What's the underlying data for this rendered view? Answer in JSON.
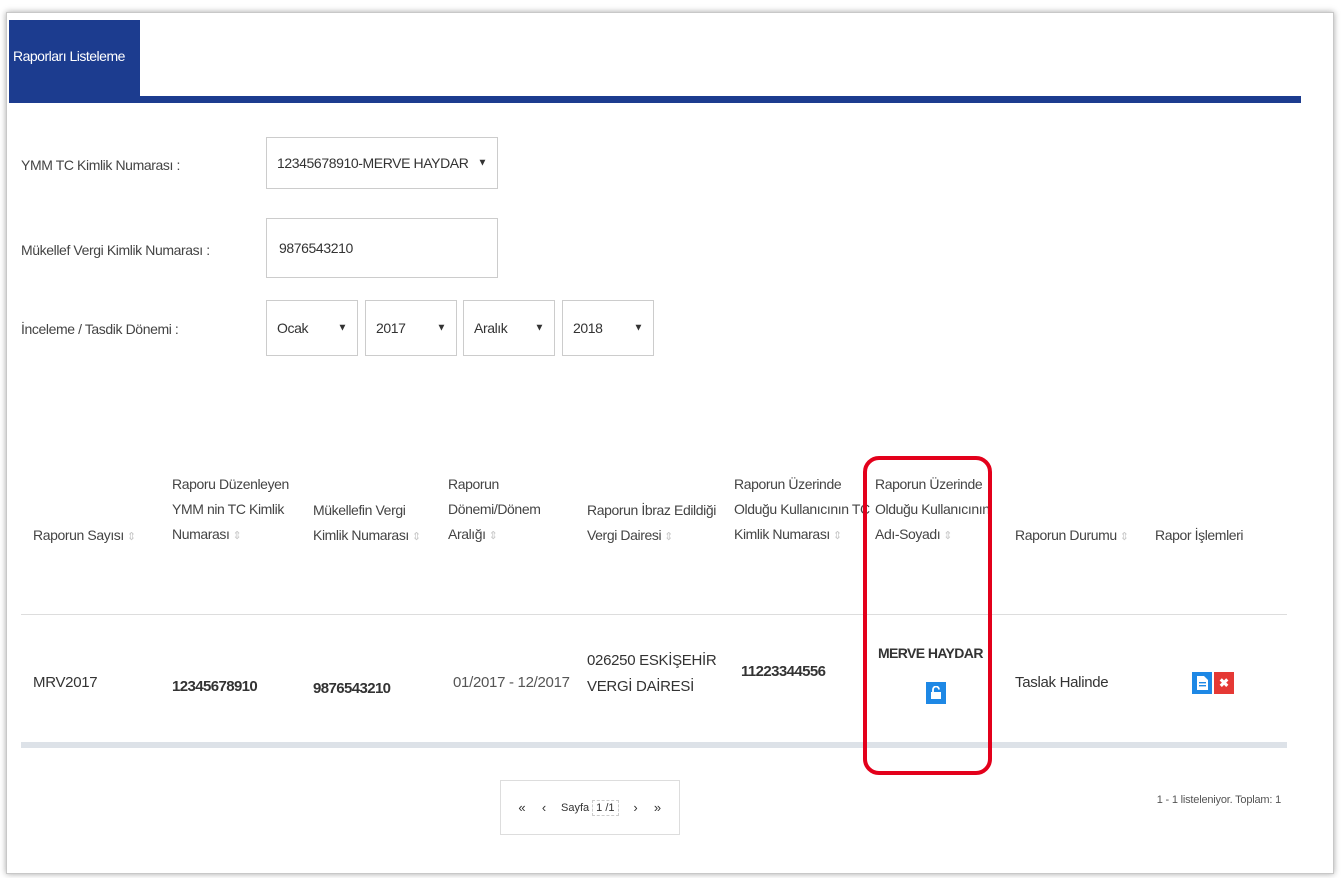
{
  "tab": {
    "label": "Raporları Listeleme"
  },
  "filters": {
    "ymm_label": "YMM TC Kimlik Numarası :",
    "ymm_value": "12345678910-MERVE HAYDAR",
    "mukellef_label": "Mükellef Vergi Kimlik Numarası :",
    "mukellef_value": "9876543210",
    "donem_label": "İnceleme / Tasdik Dönemi :",
    "start_month": "Ocak",
    "start_year": "2017",
    "end_month": "Aralık",
    "end_year": "2018"
  },
  "table": {
    "headers": [
      [
        "Raporun Sayısı"
      ],
      [
        "Raporu Düzenleyen",
        "YMM nin TC Kimlik",
        "Numarası"
      ],
      [
        "Mükellefin Vergi",
        "Kimlik Numarası"
      ],
      [
        "Raporun",
        "Dönemi/Dönem",
        "Aralığı"
      ],
      [
        "Raporun İbraz Edildiği",
        "Vergi Dairesi"
      ],
      [
        "Raporun Üzerinde",
        "Olduğu Kullanıcının TC",
        "Kimlik Numarası"
      ],
      [
        "Raporun Üzerinde",
        "Olduğu Kullanıcının",
        "Adı-Soyadı"
      ],
      [
        "Raporun Durumu"
      ],
      [
        "Rapor İşlemleri"
      ]
    ],
    "rows": [
      {
        "sayi": "MRV2017",
        "ymm_tc": "12345678910",
        "vkn": "9876543210",
        "donem": "01/2017 - 12/2017",
        "vergi_dairesi_1": "026250 ESKİŞEHİR",
        "vergi_dairesi_2": "VERGİ DAİRESİ",
        "kullanici_tc": "11223344556",
        "kullanici_ad": "MERVE HAYDAR",
        "durum": "Taslak Halinde"
      }
    ]
  },
  "pager": {
    "first": "«",
    "prev": "‹",
    "label": "Sayfa",
    "page": "1 /1",
    "next": "›",
    "last": "»"
  },
  "summary": "1 - 1 listeleniyor. Toplam: 1",
  "icons": {
    "unlock": "unlock-icon",
    "document": "document-icon",
    "delete": "delete-icon"
  },
  "colors": {
    "primary": "#1c3c8f",
    "action_blue": "#1e88e5",
    "action_red": "#e53935",
    "highlight": "#e3001b"
  }
}
